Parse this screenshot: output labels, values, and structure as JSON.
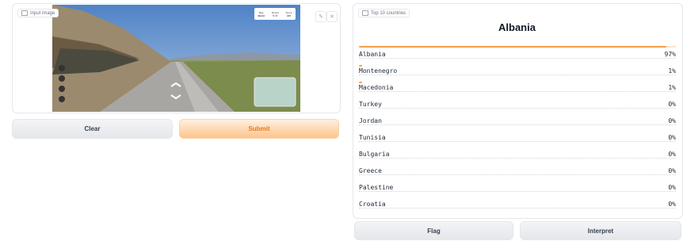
{
  "input_panel": {
    "label": "Input image"
  },
  "street_view_hud": {
    "cols": [
      {
        "label": "Map",
        "value": "World"
      },
      {
        "label": "Round",
        "value": "5 / 5"
      },
      {
        "label": "Score",
        "value": "247"
      }
    ]
  },
  "buttons": {
    "clear": "Clear",
    "submit": "Submit",
    "flag": "Flag",
    "interpret": "Interpret"
  },
  "output_panel": {
    "label": "Top 10 countries",
    "top_prediction": "Albania",
    "rows": [
      {
        "name": "Albania",
        "pct": "97%",
        "value": 0.97
      },
      {
        "name": "Montenegro",
        "pct": "1%",
        "value": 0.01
      },
      {
        "name": "Macedonia",
        "pct": "1%",
        "value": 0.01
      },
      {
        "name": "Turkey",
        "pct": "0%",
        "value": 0
      },
      {
        "name": "Jordan",
        "pct": "0%",
        "value": 0
      },
      {
        "name": "Tunisia",
        "pct": "0%",
        "value": 0
      },
      {
        "name": "Bulgaria",
        "pct": "0%",
        "value": 0
      },
      {
        "name": "Greece",
        "pct": "0%",
        "value": 0
      },
      {
        "name": "Palestine",
        "pct": "0%",
        "value": 0
      },
      {
        "name": "Croatia",
        "pct": "0%",
        "value": 0
      }
    ]
  },
  "colors": {
    "accent": "#f59e4b",
    "submit_text": "#ea7a1a"
  }
}
